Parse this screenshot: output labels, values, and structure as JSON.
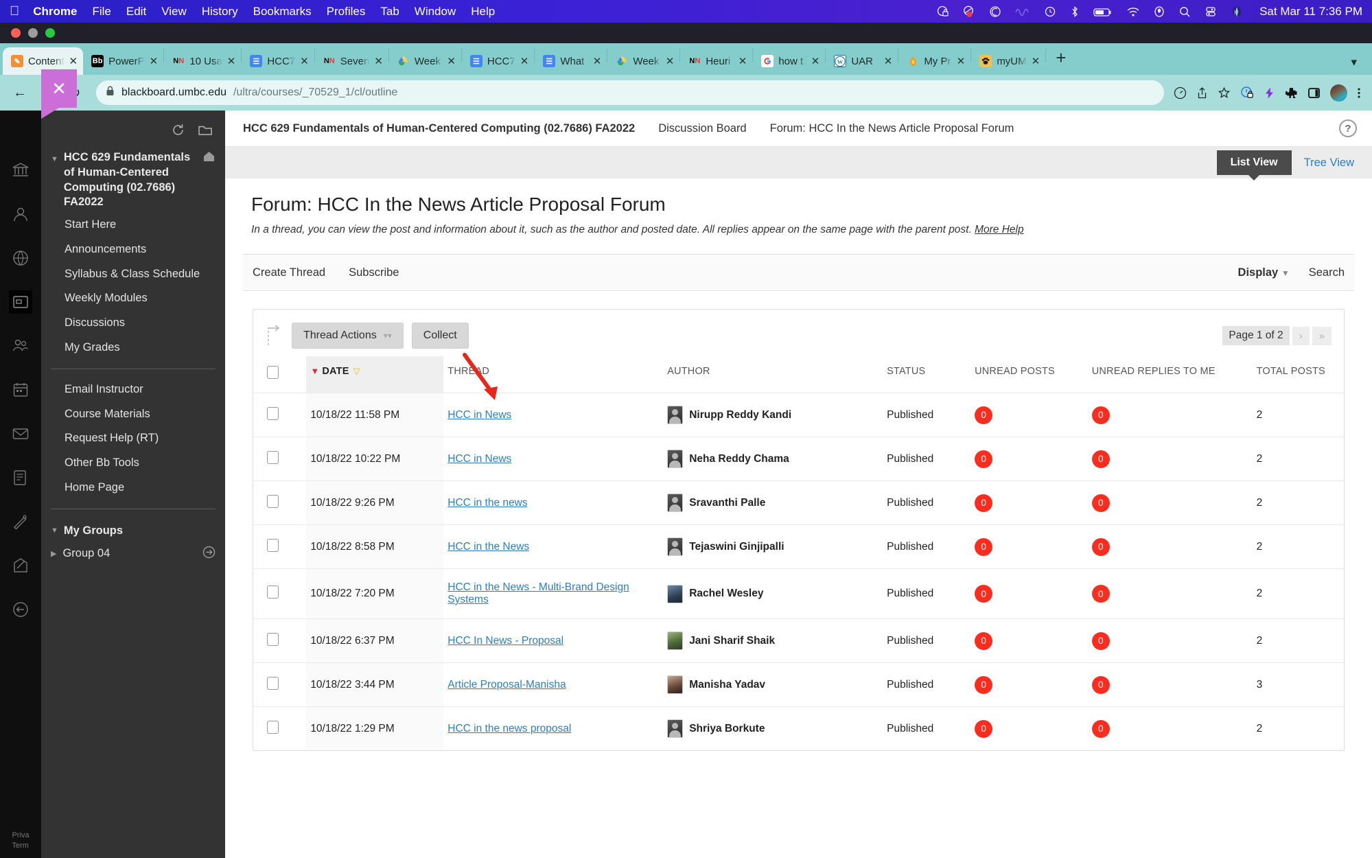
{
  "menubar": {
    "apple": "",
    "items": [
      {
        "label": "Chrome",
        "bold": true
      },
      {
        "label": "File",
        "bold": false
      },
      {
        "label": "Edit",
        "bold": false
      },
      {
        "label": "View",
        "bold": false
      },
      {
        "label": "History",
        "bold": false
      },
      {
        "label": "Bookmarks",
        "bold": false
      },
      {
        "label": "Profiles",
        "bold": false
      },
      {
        "label": "Tab",
        "bold": false
      },
      {
        "label": "Window",
        "bold": false
      },
      {
        "label": "Help",
        "bold": false
      }
    ],
    "status_icons": [
      "lock-circle-icon",
      "record-dot-icon",
      "spiral-icon",
      "wave-icon",
      "clock-icon",
      "bluetooth-icon",
      "battery-icon",
      "wifi-icon",
      "microphone-icon",
      "search-icon",
      "control-center-icon",
      "aurora-icon"
    ],
    "clock": "Sat Mar 11  7:36 PM"
  },
  "tabs": [
    {
      "label": "Content",
      "icon": "pencil-note-icon",
      "iconclass": "fv-orange",
      "glyph": "✎",
      "active": true
    },
    {
      "label": "PowerP",
      "icon": "blackboard-icon",
      "iconclass": "fv-black",
      "glyph": "Bb",
      "active": false
    },
    {
      "label": "10 Usa",
      "icon": "nielsen-norman-icon",
      "iconclass": "fv-nn",
      "glyph": "NN",
      "active": false
    },
    {
      "label": "HCC7",
      "icon": "google-docs-icon",
      "iconclass": "fv-docs",
      "glyph": "≡",
      "active": false
    },
    {
      "label": "Seven",
      "icon": "nielsen-norman-icon",
      "iconclass": "fv-nn",
      "glyph": "NN",
      "active": false
    },
    {
      "label": "Week",
      "icon": "google-drive-icon",
      "iconclass": "fv-drive",
      "glyph": "▲",
      "active": false
    },
    {
      "label": "HCC7",
      "icon": "google-docs-icon",
      "iconclass": "fv-docs",
      "glyph": "≡",
      "active": false
    },
    {
      "label": "What",
      "icon": "google-docs-icon",
      "iconclass": "fv-docs",
      "glyph": "≡",
      "active": false
    },
    {
      "label": "Week",
      "icon": "google-drive-icon",
      "iconclass": "fv-drive",
      "glyph": "▲",
      "active": false
    },
    {
      "label": "Heuri",
      "icon": "nielsen-norman-icon",
      "iconclass": "fv-nn",
      "glyph": "NN",
      "active": false
    },
    {
      "label": "how t",
      "icon": "google-search-icon",
      "iconclass": "fv-google",
      "glyph": "G",
      "active": false
    },
    {
      "label": "UAR",
      "icon": "wordpress-icon",
      "iconclass": "fv-wp",
      "glyph": "W",
      "active": false
    },
    {
      "label": "My Pr",
      "icon": "flame-icon",
      "iconclass": "fv-flame",
      "glyph": "🔥",
      "active": false
    },
    {
      "label": "myUM",
      "icon": "paw-icon",
      "iconclass": "fv-paw",
      "glyph": "🐾",
      "active": false
    }
  ],
  "tab_new_label": "+",
  "omnibox": {
    "back": "←",
    "forward": "→",
    "reload": "↻",
    "lock": "🔒",
    "url_host": "blackboard.umbc.edu",
    "url_path": "/ultra/courses/_70529_1/cl/outline",
    "right_icons": [
      "dashboard-icon",
      "share-icon",
      "bookmark-star-icon",
      "timer-lock-icon",
      "lightning-icon",
      "extensions-puzzle-icon",
      "side-panel-icon",
      "profile-avatar",
      "kebab-menu-icon"
    ]
  },
  "breadcrumb": {
    "course": "HCC 629 Fundamentals of Human-Centered Computing (02.7686) FA2022",
    "section": "Discussion Board",
    "forum": "Forum: HCC In the News Article Proposal Forum",
    "help": "?"
  },
  "viewbar": {
    "list_view": "List View",
    "tree_view": "Tree View"
  },
  "main": {
    "title": "Forum: HCC In the News Article Proposal Forum",
    "description": "In a thread, you can view the post and information about it, such as the author and posted date. All replies appear on the same page with the parent post.",
    "more_help": "More Help",
    "create_thread": "Create Thread",
    "subscribe": "Subscribe",
    "display": "Display",
    "search": "Search"
  },
  "table_tools": {
    "thread_actions": "Thread Actions",
    "collect": "Collect",
    "page_label": "Page 1 of 2",
    "next_page": "›",
    "last_page": "»"
  },
  "table": {
    "columns": [
      "",
      "DATE",
      "THREAD",
      "AUTHOR",
      "STATUS",
      "UNREAD POSTS",
      "UNREAD REPLIES TO ME",
      "TOTAL POSTS"
    ],
    "col_date": "DATE",
    "col_thread": "THREAD",
    "col_author": "AUTHOR",
    "col_status": "STATUS",
    "col_unread_posts": "UNREAD POSTS",
    "col_unread_replies": "UNREAD REPLIES TO ME",
    "col_total_posts": "TOTAL POSTS",
    "rows": [
      {
        "date": "10/18/22 11:58 PM",
        "thread": "HCC in News",
        "author": "Nirupp Reddy Kandi",
        "avatar": "p4",
        "status": "Published",
        "unread_posts": "0",
        "unread_replies": "0",
        "total_posts": "2"
      },
      {
        "date": "10/18/22 10:22 PM",
        "thread": "HCC in News",
        "author": "Neha Reddy Chama",
        "avatar": "p4",
        "status": "Published",
        "unread_posts": "0",
        "unread_replies": "0",
        "total_posts": "2"
      },
      {
        "date": "10/18/22 9:26 PM",
        "thread": "HCC in the news",
        "author": "Sravanthi Palle",
        "avatar": "p4",
        "status": "Published",
        "unread_posts": "0",
        "unread_replies": "0",
        "total_posts": "2"
      },
      {
        "date": "10/18/22 8:58 PM",
        "thread": "HCC in the News",
        "author": "Tejaswini Ginjipalli",
        "avatar": "p4",
        "status": "Published",
        "unread_posts": "0",
        "unread_replies": "0",
        "total_posts": "2"
      },
      {
        "date": "10/18/22 7:20 PM",
        "thread": "HCC in the News - Multi-Brand Design Systems",
        "author": "Rachel Wesley",
        "avatar": "p1",
        "status": "Published",
        "unread_posts": "0",
        "unread_replies": "0",
        "total_posts": "2"
      },
      {
        "date": "10/18/22 6:37 PM",
        "thread": "HCC In News - Proposal",
        "author": "Jani Sharif Shaik",
        "avatar": "p2",
        "status": "Published",
        "unread_posts": "0",
        "unread_replies": "0",
        "total_posts": "2"
      },
      {
        "date": "10/18/22 3:44 PM",
        "thread": "Article Proposal-Manisha",
        "author": "Manisha Yadav",
        "avatar": "p3",
        "status": "Published",
        "unread_posts": "0",
        "unread_replies": "0",
        "total_posts": "3"
      },
      {
        "date": "10/18/22 1:29 PM",
        "thread": "HCC in the news proposal",
        "author": "Shriya Borkute",
        "avatar": "p4",
        "status": "Published",
        "unread_posts": "0",
        "unread_replies": "0",
        "total_posts": "2"
      }
    ]
  },
  "course_menu": {
    "title": "HCC 629 Fundamentals of Human-Centered Computing (02.7686) FA2022",
    "links": [
      "Start Here",
      "Announcements",
      "Syllabus & Class Schedule",
      "Weekly Modules",
      "Discussions",
      "My Grades"
    ],
    "links2": [
      "Email Instructor",
      "Course Materials",
      "Request Help (RT)",
      "Other Bb Tools",
      "Home Page"
    ],
    "groups_title": "My Groups",
    "group_item": "Group 04",
    "close": "✕"
  },
  "rail": {
    "privacy": "Priva",
    "terms": "Term"
  },
  "colors": {
    "accent_purple": "#cc6ed8",
    "link_blue": "#2a7fc9",
    "badge_red": "#fc2d1f",
    "menubar_blue": "#3b21d6",
    "tabstrip_teal": "#84cdcc"
  }
}
